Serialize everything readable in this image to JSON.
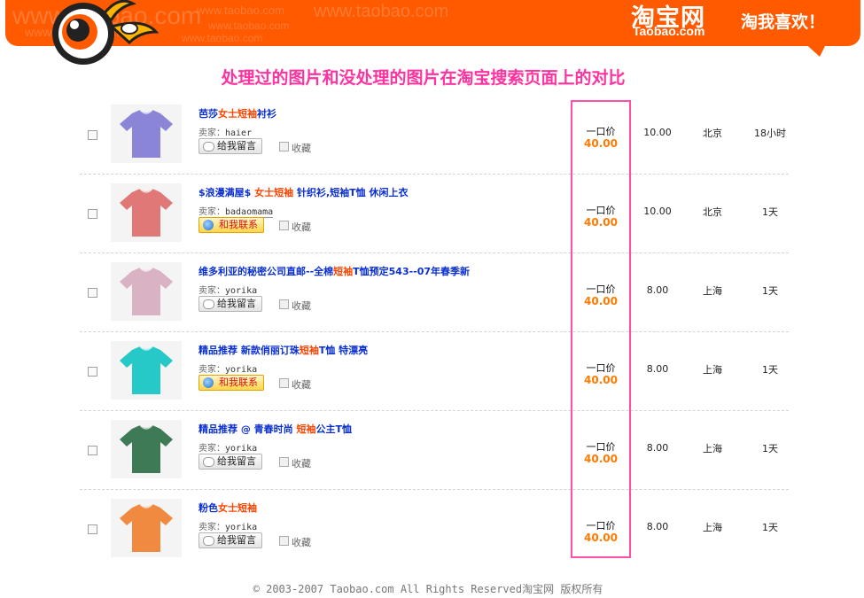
{
  "header": {
    "watermarks": [
      "www.taobao.com",
      "www.taobao.com",
      "www.taobao.com",
      "www.taobao.com",
      "www.taobao.com",
      "www.taobao.com"
    ],
    "logo_cn": "淘宝网",
    "logo_en": "Taobao.com",
    "slogan": "淘我喜欢！",
    "brand_color": "#ff5a00"
  },
  "page_title": "处理过的图片和没处理的图片在淘宝搜索页面上的对比",
  "seller_label": "卖家：",
  "fav_label": "收藏",
  "price_label": "一口价",
  "items": [
    {
      "title_pre": "芭莎",
      "title_hl": "女士短袖",
      "title_post": "衬衫",
      "seller": "haier",
      "button": "给我留言",
      "price": "40.00",
      "shipping": "10.00",
      "city": "北京",
      "time": "18小时",
      "shirt_color": "#8b85d8"
    },
    {
      "title_pre": "$浪漫满屋$ ",
      "title_hl": "女士短袖",
      "title_post": " 针织衫,短袖T恤 休闲上衣",
      "seller": "badaomama",
      "button": "和我联系",
      "price": "40.00",
      "shipping": "10.00",
      "city": "北京",
      "time": "1天",
      "shirt_color": "#e07878"
    },
    {
      "title_pre": "维多利亚的秘密公司直邮--全棉",
      "title_hl": "短袖",
      "title_post": "T恤预定543--07年春季新",
      "seller": "yorika",
      "button": "给我留言",
      "price": "40.00",
      "shipping": "8.00",
      "city": "上海",
      "time": "1天",
      "shirt_color": "#d9b2c4"
    },
    {
      "title_pre": "精品推荐 新款俏丽订珠",
      "title_hl": "短袖",
      "title_post": "T恤 特漂亮",
      "seller": "yorika",
      "button": "和我联系",
      "price": "40.00",
      "shipping": "8.00",
      "city": "上海",
      "time": "1天",
      "shirt_color": "#27c8c8"
    },
    {
      "title_pre": "精品推荐 @ 青春时尚 ",
      "title_hl": "短袖",
      "title_post": "公主T恤",
      "seller": "yorika",
      "button": "给我留言",
      "price": "40.00",
      "shipping": "8.00",
      "city": "上海",
      "time": "1天",
      "shirt_color": "#3d7a55"
    },
    {
      "title_pre": "粉色",
      "title_hl": "女士短袖",
      "title_post": "",
      "seller": "yorika",
      "button": "给我留言",
      "price": "40.00",
      "shipping": "8.00",
      "city": "上海",
      "time": "1天",
      "shirt_color": "#f08a40"
    }
  ],
  "footer": "© 2003-2007 Taobao.com All Rights Reserved淘宝网 版权所有",
  "highlight_color": "#ff4fa8"
}
